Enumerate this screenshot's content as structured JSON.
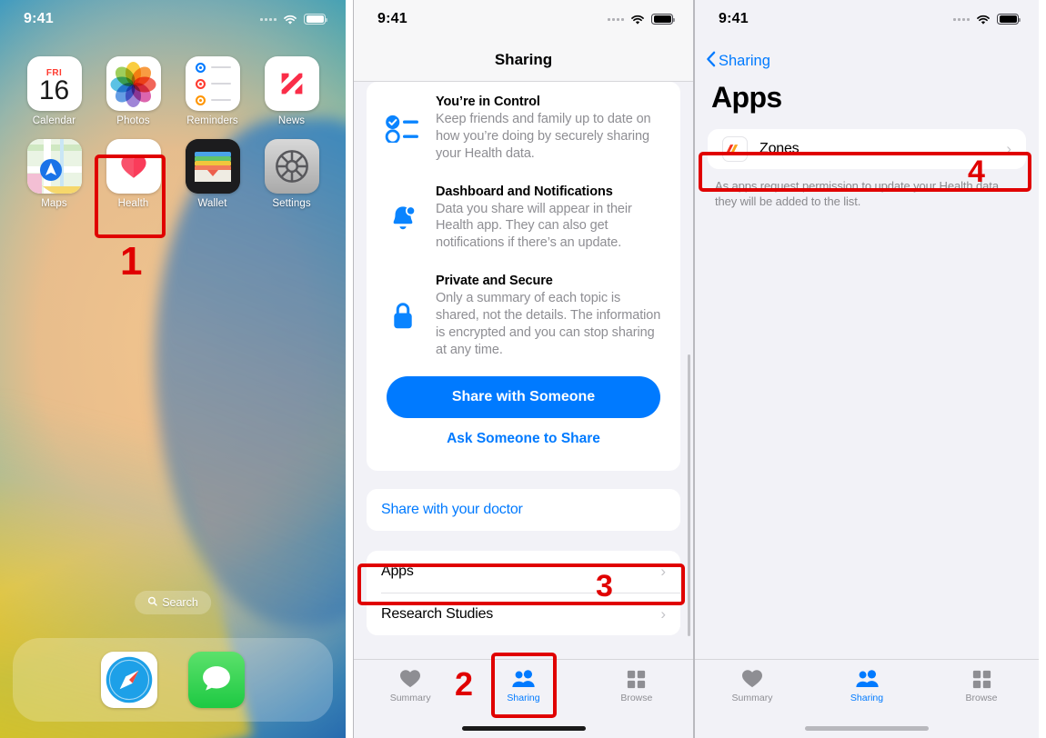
{
  "panels": {
    "home": {
      "status": {
        "time": "9:41",
        "signal_icon": "signal-dots-icon",
        "wifi_icon": "wifi-icon",
        "battery_icon": "battery-icon"
      },
      "apps_row1": [
        {
          "label": "Calendar",
          "icon": "calendar-icon",
          "day": "FRI",
          "date": "16"
        },
        {
          "label": "Photos",
          "icon": "photos-icon"
        },
        {
          "label": "Reminders",
          "icon": "reminders-icon"
        },
        {
          "label": "News",
          "icon": "news-icon"
        }
      ],
      "apps_row2": [
        {
          "label": "Maps",
          "icon": "maps-icon"
        },
        {
          "label": "Health",
          "icon": "health-icon"
        },
        {
          "label": "Wallet",
          "icon": "wallet-icon"
        },
        {
          "label": "Settings",
          "icon": "settings-icon"
        }
      ],
      "search": {
        "label": "Search",
        "icon": "search-icon"
      },
      "dock": [
        {
          "label": "Safari",
          "icon": "safari-icon"
        },
        {
          "label": "Messages",
          "icon": "messages-icon"
        }
      ],
      "step": "1"
    },
    "sharing": {
      "status": {
        "time": "9:41"
      },
      "nav_title": "Sharing",
      "features": [
        {
          "icon": "checklist-icon",
          "heading": "You’re in Control",
          "body": "Keep friends and family up to date on how you’re doing by securely sharing your Health data."
        },
        {
          "icon": "bell-icon",
          "heading": "Dashboard and Notifications",
          "body": "Data you share will appear in their Health app. They can also get notifications if there’s an update."
        },
        {
          "icon": "lock-icon",
          "heading": "Private and Secure",
          "body": "Only a summary of each topic is shared, not the details. The information is encrypted and you can stop sharing at any time."
        }
      ],
      "primary_button": "Share with Someone",
      "link_button": "Ask Someone to Share",
      "doctor_row": "Share with your doctor",
      "rows": [
        {
          "label": "Apps",
          "chevron": "chevron-right-icon"
        },
        {
          "label": "Research Studies",
          "chevron": "chevron-right-icon"
        }
      ],
      "tabs": [
        {
          "label": "Summary",
          "icon": "heart-icon",
          "active": false
        },
        {
          "label": "Sharing",
          "icon": "people-icon",
          "active": true
        },
        {
          "label": "Browse",
          "icon": "grid-icon",
          "active": false
        }
      ],
      "step_tab": "2",
      "step_apps": "3"
    },
    "apps": {
      "status": {
        "time": "9:41"
      },
      "back_label": "Sharing",
      "back_icon": "chevron-left-icon",
      "title": "Apps",
      "rows": [
        {
          "label": "Zones",
          "icon": "zones-app-icon",
          "chevron": "chevron-right-icon"
        }
      ],
      "footnote": "As apps request permission to update your Health data, they will be added to the list.",
      "tabs": [
        {
          "label": "Summary",
          "icon": "heart-icon",
          "active": false
        },
        {
          "label": "Sharing",
          "icon": "people-icon",
          "active": true
        },
        {
          "label": "Browse",
          "icon": "grid-icon",
          "active": false
        }
      ],
      "step": "4"
    }
  },
  "colors": {
    "accent_blue": "#007aff",
    "annotation_red": "#e00000",
    "muted_gray": "#8e8e93",
    "group_bg": "#f2f2f7"
  }
}
